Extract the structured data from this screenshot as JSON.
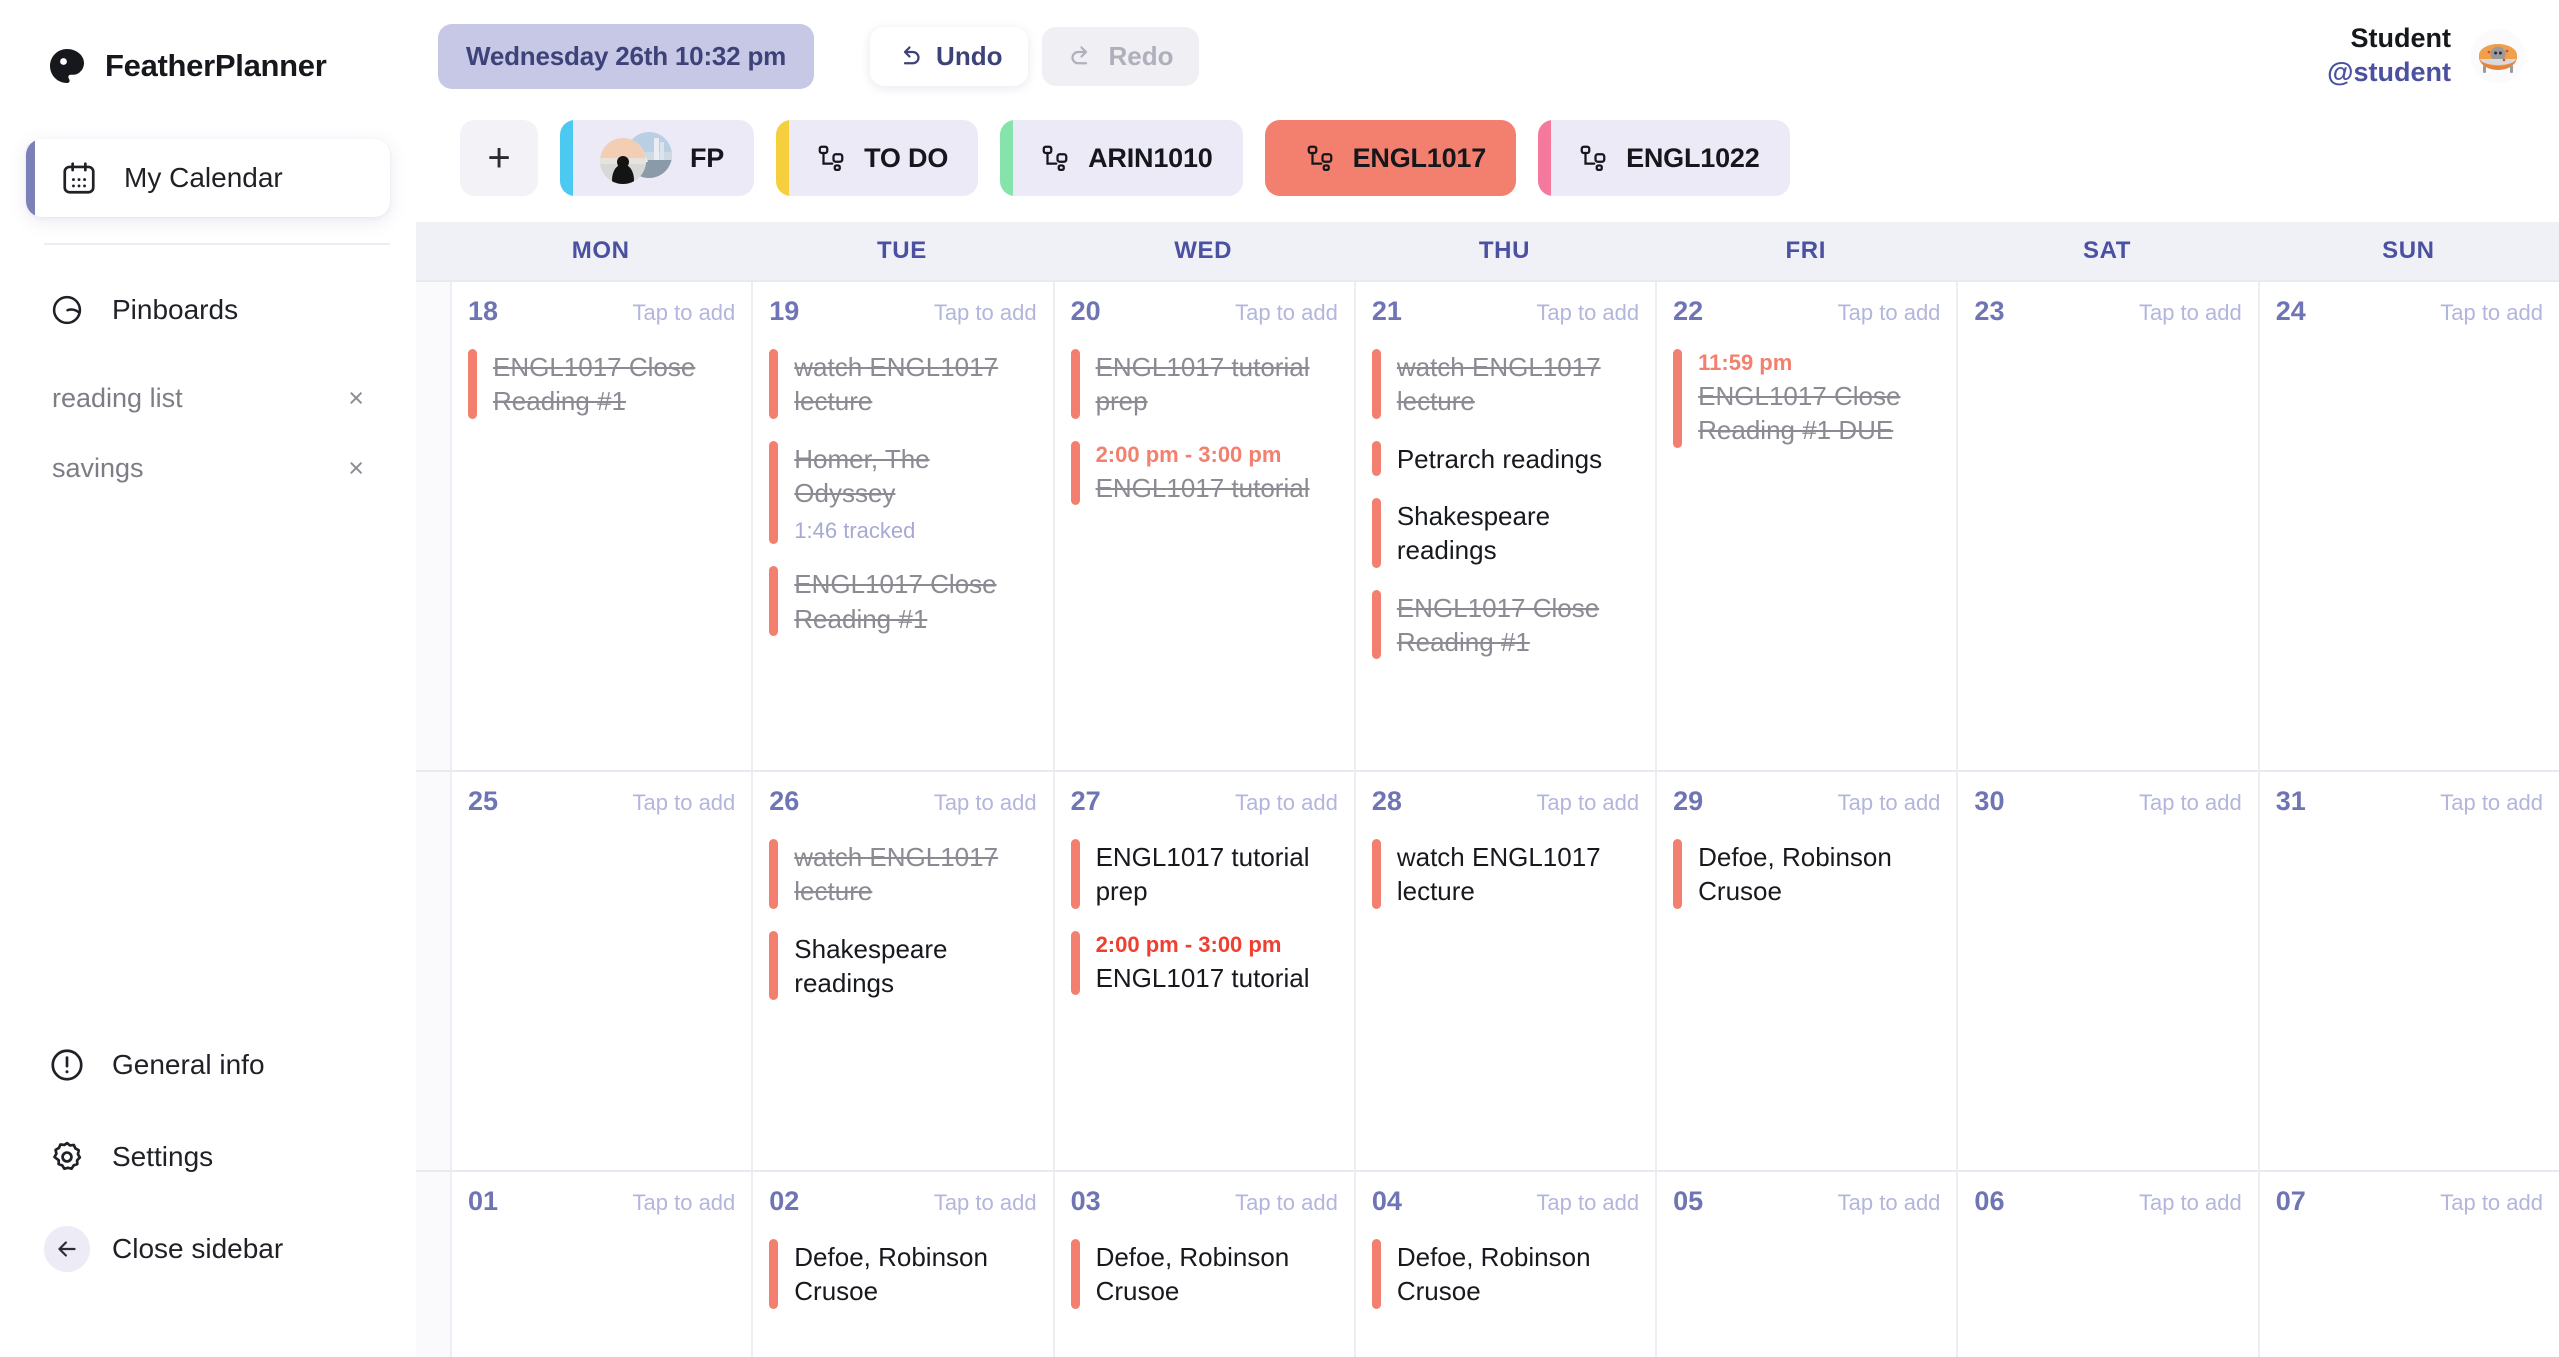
{
  "brand": {
    "name": "FeatherPlanner",
    "logo_icon": "feather-logo-icon"
  },
  "sidebar": {
    "primary": {
      "label": "My Calendar",
      "icon": "calendar-icon"
    },
    "pinboards": {
      "label": "Pinboards",
      "icon": "pinboard-icon"
    },
    "pin_items": [
      {
        "name": "reading list",
        "remove": "×"
      },
      {
        "name": "savings",
        "remove": "×"
      }
    ],
    "bottom": [
      {
        "label": "General info",
        "icon": "info-circle-icon"
      },
      {
        "label": "Settings",
        "icon": "gear-icon"
      },
      {
        "label": "Close sidebar",
        "icon": "arrow-left-icon"
      }
    ]
  },
  "topbar": {
    "datetime": "Wednesday 26th 10:32 pm",
    "undo_label": "Undo",
    "redo_label": "Redo",
    "undo_icon": "undo-arrow-icon",
    "redo_icon": "redo-arrow-icon",
    "user_name": "Student",
    "user_handle": "@student"
  },
  "tabs": {
    "add_label": "+",
    "items": [
      {
        "label": "FP",
        "color": "#4cc9f0",
        "active": false,
        "icon": "avatar-group-icon"
      },
      {
        "label": "TO DO",
        "color": "#f6cf3f",
        "active": false,
        "icon": "category-icon"
      },
      {
        "label": "ARIN1010",
        "color": "#86e3ab",
        "active": false,
        "icon": "category-icon"
      },
      {
        "label": "ENGL1017",
        "color": "#f3806e",
        "active": true,
        "icon": "category-icon"
      },
      {
        "label": "ENGL1022",
        "color": "#f5799c",
        "active": false,
        "icon": "category-icon"
      }
    ]
  },
  "calendar": {
    "day_headers": [
      "MON",
      "TUE",
      "WED",
      "THU",
      "FRI",
      "SAT",
      "SUN"
    ],
    "tap_to_add": "Tap to add",
    "weeks": [
      {
        "days": [
          {
            "num": "18",
            "events": [
              {
                "title": "ENGL1017 Close Reading #1",
                "done": true
              }
            ]
          },
          {
            "num": "19",
            "events": [
              {
                "title": "watch ENGL1017 lecture",
                "done": true
              },
              {
                "title": "Homer, The Odyssey",
                "done": true,
                "tracked": "1:46 tracked"
              },
              {
                "title": "ENGL1017 Close Reading #1",
                "done": true
              }
            ]
          },
          {
            "num": "20",
            "events": [
              {
                "title": "ENGL1017 tutorial prep",
                "done": true
              },
              {
                "time": "2:00 pm - 3:00 pm",
                "title": "ENGL1017 tutorial",
                "done": true
              }
            ]
          },
          {
            "num": "21",
            "events": [
              {
                "title": "watch ENGL1017 lecture",
                "done": true
              },
              {
                "title": "Petrarch readings",
                "done": false
              },
              {
                "title": "Shakespeare readings",
                "done": false
              },
              {
                "title": "ENGL1017 Close Reading #1",
                "done": true
              }
            ]
          },
          {
            "num": "22",
            "events": [
              {
                "time": "11:59 pm",
                "title": "ENGL1017 Close Reading #1 DUE",
                "done": true
              }
            ]
          },
          {
            "num": "23",
            "events": []
          },
          {
            "num": "24",
            "events": []
          }
        ]
      },
      {
        "days": [
          {
            "num": "25",
            "events": []
          },
          {
            "num": "26",
            "events": [
              {
                "title": "watch ENGL1017 lecture",
                "done": true
              },
              {
                "title": "Shakespeare readings",
                "done": false
              }
            ]
          },
          {
            "num": "27",
            "events": [
              {
                "title": "ENGL1017 tutorial prep",
                "done": false
              },
              {
                "time": "2:00 pm - 3:00 pm",
                "time_strong": true,
                "title": "ENGL1017 tutorial",
                "done": false
              }
            ]
          },
          {
            "num": "28",
            "events": [
              {
                "title": "watch ENGL1017 lecture",
                "done": false
              }
            ]
          },
          {
            "num": "29",
            "events": [
              {
                "title": "Defoe, Robinson Crusoe",
                "done": false
              }
            ]
          },
          {
            "num": "30",
            "events": []
          },
          {
            "num": "31",
            "events": []
          }
        ]
      },
      {
        "days": [
          {
            "num": "01",
            "events": []
          },
          {
            "num": "02",
            "events": [
              {
                "title": "Defoe, Robinson Crusoe",
                "done": false
              }
            ]
          },
          {
            "num": "03",
            "events": [
              {
                "title": "Defoe, Robinson Crusoe",
                "done": false
              }
            ]
          },
          {
            "num": "04",
            "events": [
              {
                "title": "Defoe, Robinson Crusoe",
                "done": false
              }
            ]
          },
          {
            "num": "05",
            "events": []
          },
          {
            "num": "06",
            "events": []
          },
          {
            "num": "07",
            "events": []
          }
        ]
      }
    ]
  },
  "colors": {
    "accent_indigo": "#4b51a0",
    "event_coral": "#f3806e",
    "date_pill_bg": "#c7c8e6",
    "header_band": "#f0f0f7"
  }
}
